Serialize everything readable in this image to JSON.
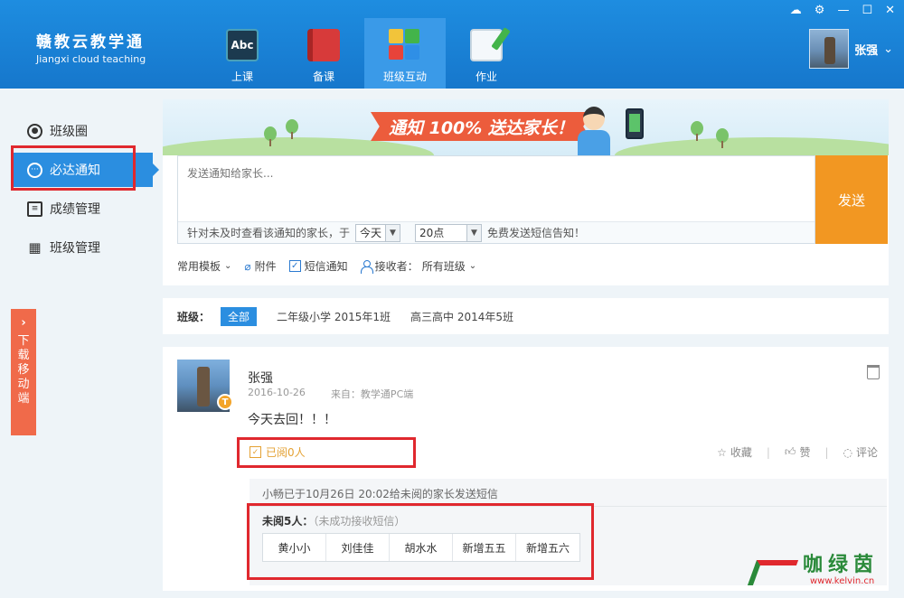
{
  "app": {
    "name_cn": "赣教云教学通",
    "name_en": "Jiangxi cloud teaching"
  },
  "topnav": {
    "items": [
      {
        "label": "上课",
        "icon": "abc-board-icon",
        "icon_text": "Abc"
      },
      {
        "label": "备课",
        "icon": "book-icon"
      },
      {
        "label": "班级互动",
        "icon": "class-interaction-icon"
      },
      {
        "label": "作业",
        "icon": "homework-icon"
      }
    ],
    "active": "班级互动"
  },
  "window": {
    "controls": [
      "cloud-icon",
      "settings-icon",
      "minimize-icon",
      "maximize-icon",
      "close-icon"
    ]
  },
  "user": {
    "name": "张强",
    "dropdown": "⌄"
  },
  "sidebar": {
    "items": [
      {
        "label": "班级圈",
        "icon": "person-circle-icon"
      },
      {
        "label": "必达通知",
        "icon": "chat-dots-icon"
      },
      {
        "label": "成绩管理",
        "icon": "clipboard-icon"
      },
      {
        "label": "班级管理",
        "icon": "grid-icon"
      }
    ],
    "active": "必达通知"
  },
  "download_tab": {
    "arrow": "›",
    "label": [
      "下",
      "载",
      "移",
      "动",
      "端"
    ]
  },
  "composer": {
    "banner_text": "通知 100% 送达家长！",
    "placeholder": "发送通知给家长...",
    "sms_hint_prefix": "针对未及时查看该通知的家长，于",
    "day_value": "今天",
    "hour_value": "20点",
    "sms_hint_suffix": "免费发送短信告知！",
    "send_label": "发送",
    "templates_label": "常用模板",
    "attachment_label": "附件",
    "sms_notify_label": "短信通知",
    "sms_notify_checked": true,
    "receiver_label": "接收者：",
    "receiver_value": "所有班级"
  },
  "class_filter": {
    "label": "班级：",
    "options": [
      "全部",
      "二年级小学 2015年1班",
      "高三高中 2014年5班"
    ],
    "active": "全部"
  },
  "post": {
    "author": "张强",
    "badge": "T",
    "date": "2016-10-26",
    "source": "来自：教学通PC端",
    "content": "今天去回！！！",
    "read_status": "已阅0人",
    "actions": {
      "favorite": "收藏",
      "like": "赞",
      "comment": "评论"
    },
    "sms_note": "小畅已于10月26日 20:02给未阅的家长发送短信",
    "unread_count_label": "未阅5人：",
    "unread_note": "（未成功接收短信）",
    "unread_names": [
      "黄小小",
      "刘佳佳",
      "胡水水",
      "新增五五",
      "新增五六"
    ]
  },
  "watermark": {
    "text": "咖绿茵",
    "url": "www.kelvin.cn"
  },
  "colors": {
    "header": "#1677cc",
    "accent": "#2b8ee0",
    "send_button": "#f29722",
    "highlight_box": "#e0282e",
    "read_status": "#e4a133"
  }
}
